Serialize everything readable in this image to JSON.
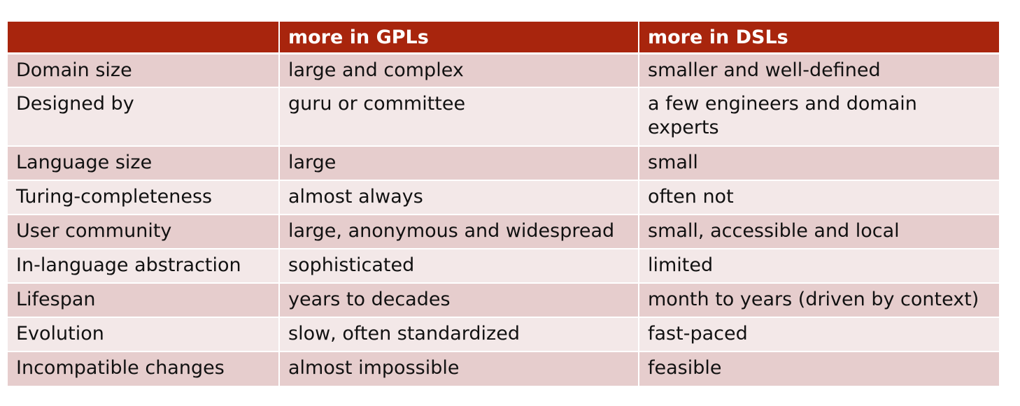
{
  "table": {
    "headers": [
      "",
      "more in GPLs",
      "more in DSLs"
    ],
    "rows": [
      [
        "Domain size",
        "large and complex",
        "smaller and well-defined"
      ],
      [
        "Designed by",
        "guru or committee",
        "a few engineers and domain experts"
      ],
      [
        "Language size",
        "large",
        "small"
      ],
      [
        "Turing-completeness",
        "almost always",
        "often not"
      ],
      [
        "User community",
        "large, anonymous and widespread",
        "small, accessible and local"
      ],
      [
        "In-language abstraction",
        "sophisticated",
        "limited"
      ],
      [
        "Lifespan",
        "years to decades",
        "month to years (driven by context)"
      ],
      [
        "Evolution",
        "slow, often standardized",
        "fast-paced"
      ],
      [
        "Incompatible changes",
        "almost impossible",
        "feasible"
      ]
    ]
  },
  "colors": {
    "header_bg": "#a8250d",
    "row_dark": "#e6cdcd",
    "row_light": "#f3e8e8"
  }
}
